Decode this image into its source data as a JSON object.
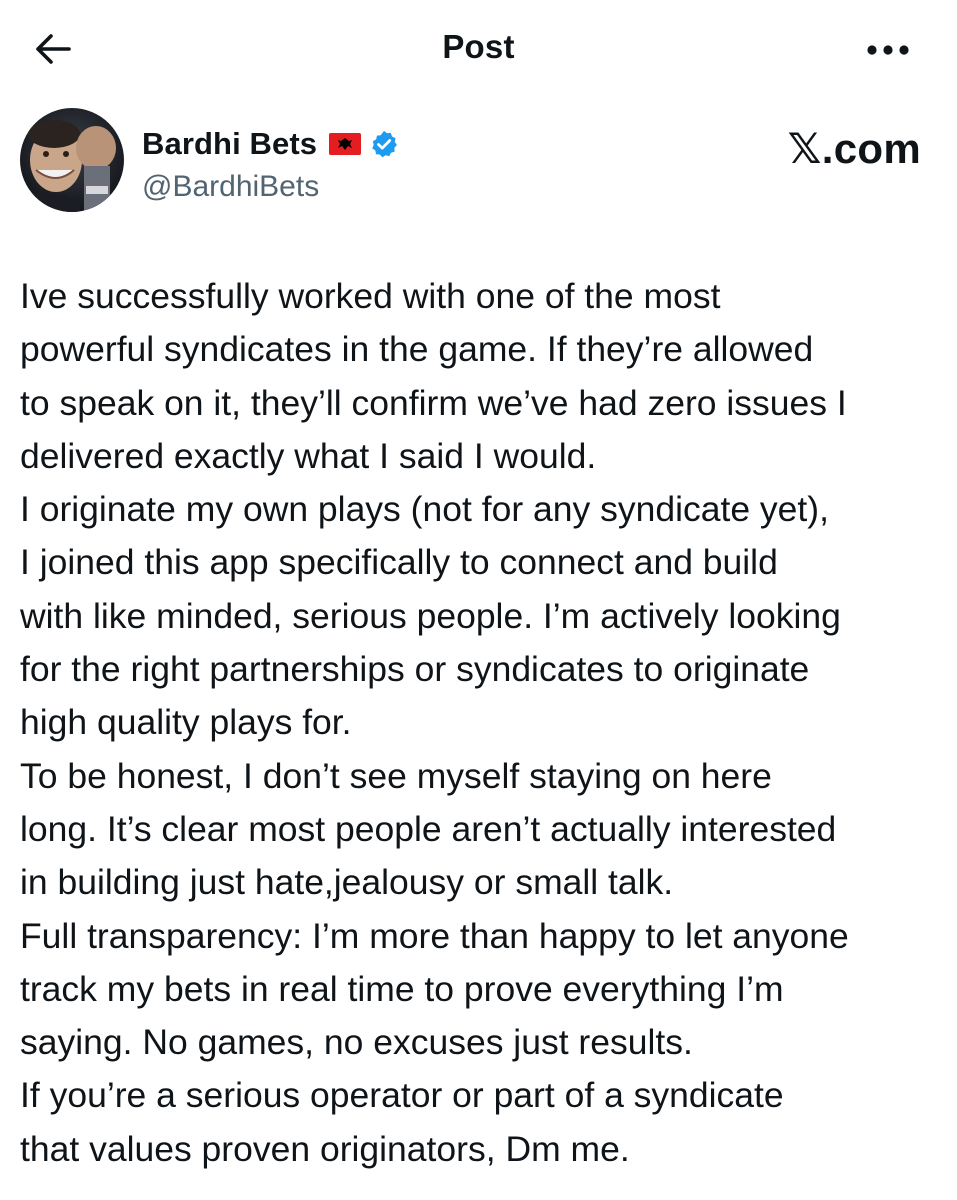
{
  "header": {
    "title": "Post",
    "back_icon": "arrow-left-icon",
    "more_icon": "more-horizontal-icon"
  },
  "author": {
    "name": "Bardhi Bets",
    "handle": "@BardhiBets",
    "flag_icon": "albania-flag-icon",
    "verified_icon": "verified-badge-icon",
    "verified_color": "#1d9bf0"
  },
  "watermark": "𝕏.com",
  "post": {
    "lines": [
      "Ive successfully worked with one of the most",
      "powerful syndicates in the game. If they’re allowed",
      "to speak on it, they’ll confirm we’ve had zero issues I",
      "delivered exactly what I said I would.",
      "I originate my own plays (not for any syndicate yet),",
      "I joined this app specifically to connect and build",
      "with like minded, serious people. I’m actively looking",
      "for the right partnerships or syndicates to originate",
      "high quality plays for.",
      "To be honest, I don’t see myself staying on here",
      "long. It’s clear most people aren’t actually interested",
      "in building just hate,jealousy or small talk.",
      "Full transparency: I’m more than happy to let anyone",
      "track my bets in real time to prove everything I’m",
      "saying. No games, no excuses just results.",
      "If you’re a serious operator or part of a syndicate",
      "that values proven originators, Dm me."
    ]
  },
  "colors": {
    "text_primary": "#0f1419",
    "text_secondary": "#536471",
    "background": "#ffffff",
    "flag_red": "#e41e20"
  }
}
